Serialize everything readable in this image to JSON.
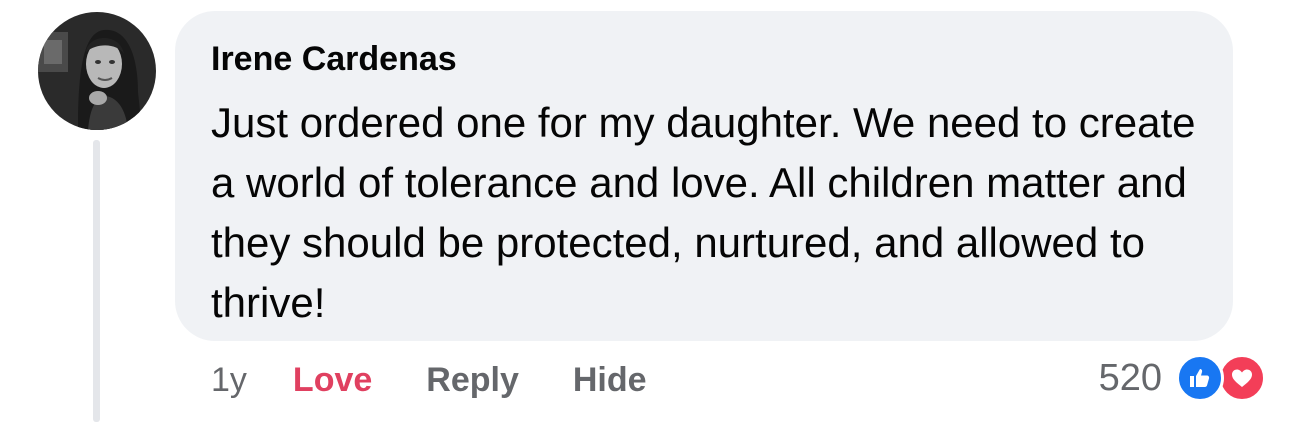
{
  "comment": {
    "author": "Irene Cardenas",
    "text": "Just ordered one for my daughter. We need to create a world of tolerance and love. All children matter and they should be protected, nurtured, and allowed to thrive!",
    "time": "1y",
    "actions": {
      "love": "Love",
      "reply": "Reply",
      "hide": "Hide"
    },
    "reaction_count": "520",
    "reaction_icons": [
      "like-icon",
      "love-icon"
    ]
  },
  "colors": {
    "bubble": "#f0f2f5",
    "love_accent": "#e04060",
    "like_blue": "#1877f2",
    "love_red": "#f33e58",
    "muted_text": "#65676b"
  }
}
